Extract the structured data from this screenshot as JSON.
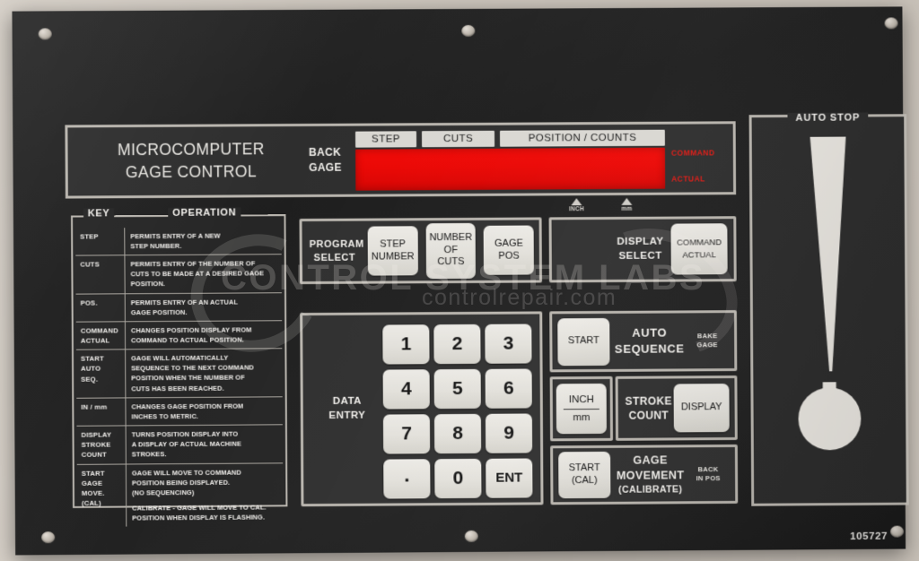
{
  "panel": {
    "part_number": "105727",
    "title_line1": "MICROCOMPUTER",
    "title_line2": "GAGE CONTROL"
  },
  "display": {
    "back_gage_line1": "BACK",
    "back_gage_line2": "GAGE",
    "columns": [
      "STEP",
      "CUTS",
      "POSITION / COUNTS"
    ],
    "readout_value": "",
    "command_label": "COMMAND",
    "actual_label": "ACTUAL",
    "unit_indicators": [
      "INCH",
      "mm"
    ]
  },
  "legend": {
    "header_key": "KEY",
    "header_operation": "OPERATION",
    "rows": [
      {
        "key": "STEP",
        "operation": "PERMITS ENTRY OF A NEW\nSTEP NUMBER."
      },
      {
        "key": "CUTS",
        "operation": "PERMITS ENTRY OF THE NUMBER OF\nCUTS TO BE MADE AT A DESIRED GAGE\nPOSITION."
      },
      {
        "key": "POS.",
        "operation": "PERMITS ENTRY OF AN ACTUAL\nGAGE POSITION."
      },
      {
        "key": "COMMAND\nACTUAL",
        "operation": "CHANGES POSITION DISPLAY FROM\nCOMMAND TO ACTUAL POSITION."
      },
      {
        "key": "START\nAUTO\nSEQ.",
        "operation": "GAGE WILL AUTOMATICALLY\nSEQUENCE TO THE NEXT COMMAND\nPOSITION WHEN THE NUMBER OF\nCUTS HAS BEEN REACHED."
      },
      {
        "key": "IN / mm",
        "operation": "CHANGES GAGE POSITION FROM\nINCHES TO METRIC."
      },
      {
        "key": "DISPLAY\nSTROKE\nCOUNT",
        "operation": "TURNS POSITION DISPLAY INTO\nA DISPLAY OF ACTUAL MACHINE\nSTROKES."
      },
      {
        "key": "START\nGAGE\nMOVE.",
        "operation": "GAGE WILL MOVE TO COMMAND\nPOSITION BEING DISPLAYED.\n(NO SEQUENCING)"
      },
      {
        "key": "(CAL)",
        "operation": "CALIBRATE - GAGE WILL MOVE TO CAL.\nPOSITION WHEN DISPLAY IS FLASHING."
      }
    ]
  },
  "program_select": {
    "label": "PROGRAM\nSELECT",
    "buttons": [
      {
        "lines": [
          "STEP",
          "NUMBER"
        ]
      },
      {
        "lines": [
          "NUMBER",
          "OF",
          "CUTS"
        ]
      },
      {
        "lines": [
          "GAGE",
          "POS"
        ]
      }
    ]
  },
  "display_select": {
    "label": "DISPLAY\nSELECT",
    "button": {
      "lines": [
        "COMMAND",
        "ACTUAL"
      ]
    }
  },
  "data_entry": {
    "label": "DATA\nENTRY",
    "keys": [
      "1",
      "2",
      "3",
      "4",
      "5",
      "6",
      "7",
      "8",
      "9",
      ".",
      "0",
      "ENT"
    ]
  },
  "auto_sequence": {
    "button": "START",
    "label": "AUTO\nSEQUENCE",
    "tiny_label": "BAKE\nGAGE"
  },
  "inch_mm": {
    "top": "INCH",
    "bottom": "mm"
  },
  "stroke_count": {
    "label": "STROKE\nCOUNT",
    "button": "DISPLAY"
  },
  "gage_movement": {
    "button": "START\n(CAL)",
    "label": "GAGE\nMOVEMENT",
    "sublabel": "(CALIBRATE)",
    "tiny_label": "BACK\nIN POS"
  },
  "auto_stop": {
    "title": "AUTO STOP",
    "symbol": "exclamation-mark"
  },
  "watermark": {
    "main": "CONTROL SYSTEM LABS",
    "sub": "controlrepair.com"
  },
  "colors": {
    "panel": "#232323",
    "bezel": "#b9b5ae",
    "led_red": "#ea0704",
    "command_red": "#e01a14",
    "keycap": "#e2e0da"
  }
}
